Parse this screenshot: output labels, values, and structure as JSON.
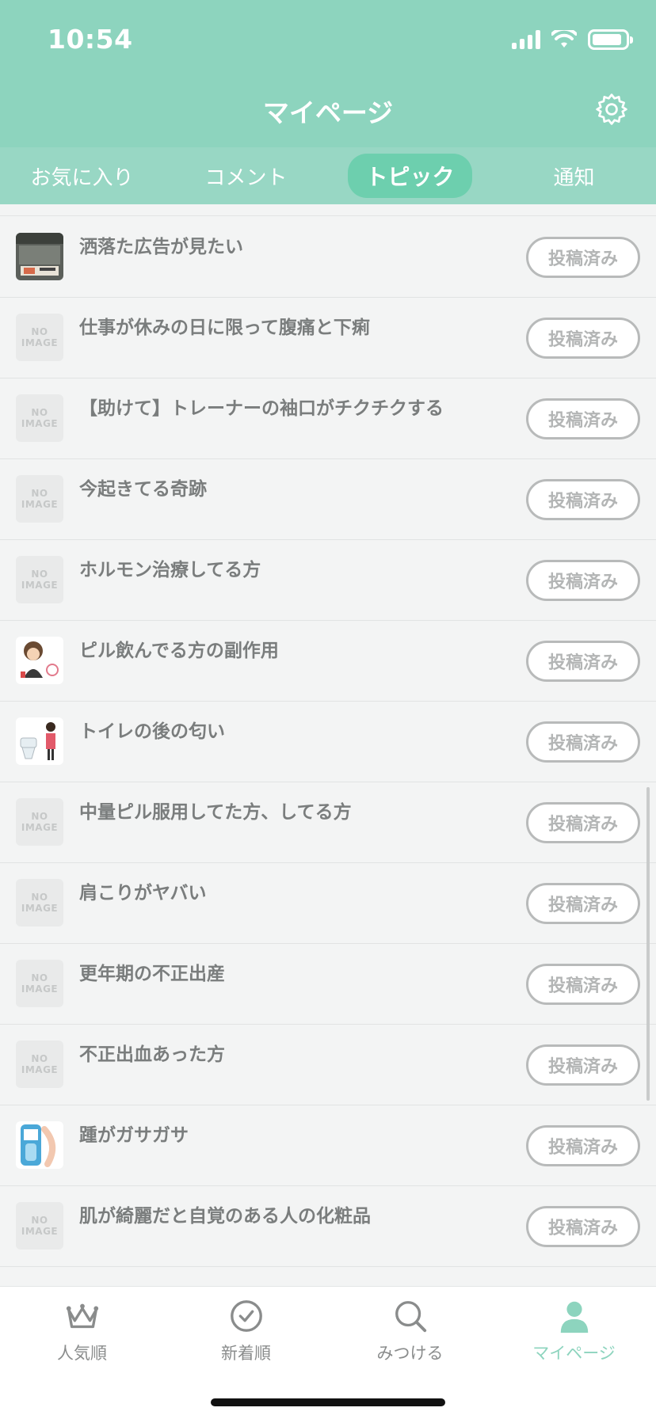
{
  "status_bar": {
    "time": "10:54"
  },
  "header": {
    "title": "マイページ",
    "settings_icon": "gear-icon"
  },
  "tabs": [
    {
      "label": "お気に入り",
      "active": false
    },
    {
      "label": "コメント",
      "active": false
    },
    {
      "label": "トピック",
      "active": true
    },
    {
      "label": "通知",
      "active": false
    }
  ],
  "no_image": {
    "line1": "NO",
    "line2": "IMAGE"
  },
  "topics": [
    {
      "title": "洒落た広告が見たい",
      "status": "投稿済み",
      "thumbnail": "photo-billboard"
    },
    {
      "title": "仕事が休みの日に限って腹痛と下痢",
      "status": "投稿済み",
      "thumbnail": "no-image"
    },
    {
      "title": "【助けて】トレーナーの袖口がチクチクする",
      "status": "投稿済み",
      "thumbnail": "no-image"
    },
    {
      "title": "今起きてる奇跡",
      "status": "投稿済み",
      "thumbnail": "no-image"
    },
    {
      "title": "ホルモン治療してる方",
      "status": "投稿済み",
      "thumbnail": "no-image"
    },
    {
      "title": "ピル飲んでる方の副作用",
      "status": "投稿済み",
      "thumbnail": "illustration-woman-pill"
    },
    {
      "title": "トイレの後の匂い",
      "status": "投稿済み",
      "thumbnail": "illustration-toilet"
    },
    {
      "title": "中量ピル服用してた方、してる方",
      "status": "投稿済み",
      "thumbnail": "no-image"
    },
    {
      "title": "肩こりがヤバい",
      "status": "投稿済み",
      "thumbnail": "no-image"
    },
    {
      "title": "更年期の不正出産",
      "status": "投稿済み",
      "thumbnail": "no-image"
    },
    {
      "title": "不正出血あった方",
      "status": "投稿済み",
      "thumbnail": "no-image"
    },
    {
      "title": "踵がガサガサ",
      "status": "投稿済み",
      "thumbnail": "photo-foot-file"
    },
    {
      "title": "肌が綺麗だと自覚のある人の化粧品",
      "status": "投稿済み",
      "thumbnail": "no-image"
    }
  ],
  "bottom_nav": [
    {
      "label": "人気順",
      "icon": "crown-icon",
      "active": false
    },
    {
      "label": "新着順",
      "icon": "clock-check-icon",
      "active": false
    },
    {
      "label": "みつける",
      "icon": "search-icon",
      "active": false
    },
    {
      "label": "マイページ",
      "icon": "person-icon",
      "active": true
    }
  ],
  "colors": {
    "brand": "#8dd4be",
    "active_pill": "#6dcfae",
    "muted_text": "#7a7d7d"
  }
}
